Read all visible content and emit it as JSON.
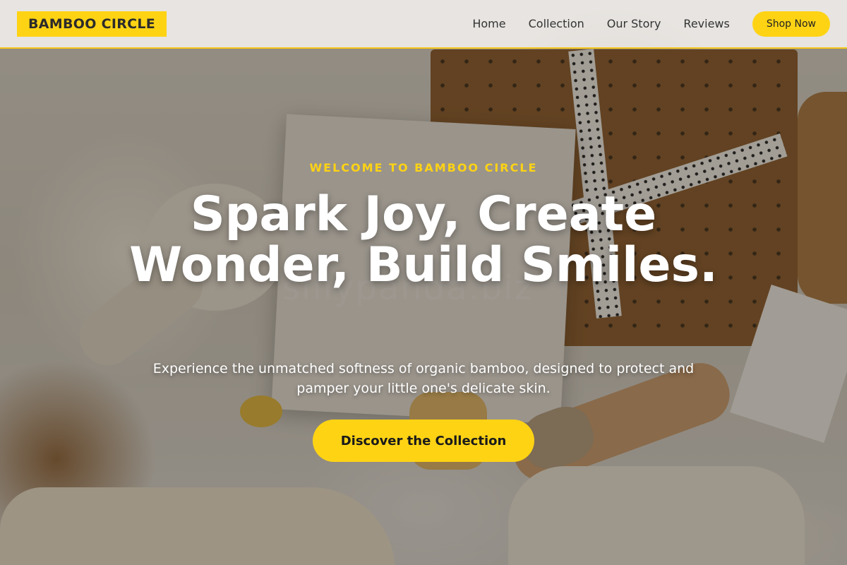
{
  "header": {
    "logo": "BAMBOO CIRCLE",
    "nav": [
      {
        "label": "Home"
      },
      {
        "label": "Collection"
      },
      {
        "label": "Our Story"
      },
      {
        "label": "Reviews"
      }
    ],
    "cta_label": "Shop Now"
  },
  "hero": {
    "eyebrow": "WELCOME TO BAMBOO CIRCLE",
    "headline": "Spark Joy, Create Wonder, Build Smiles.",
    "subtext": "Experience the unmatched softness of organic bamboo, designed to protect and pamper your little one's delicate skin.",
    "cta_label": "Discover the Collection",
    "watermark": "sillypanda.biz"
  },
  "colors": {
    "accent": "#fed314",
    "header_bg": "#f2f0ee",
    "hero_text": "#ffffff"
  }
}
